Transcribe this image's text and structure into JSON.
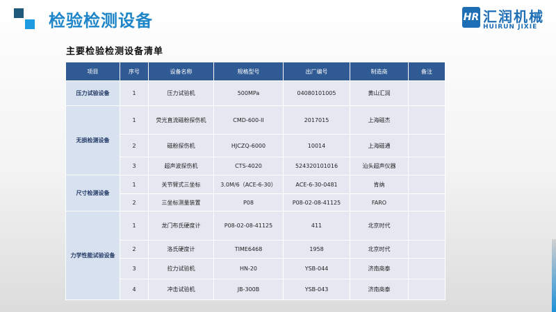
{
  "slide": {
    "title": "检验检测设备",
    "subtitle": "主要检验检测设备清单"
  },
  "logo": {
    "mark": "HR",
    "name_cn": "汇润机械",
    "name_en": "HUIRUN JIXIE"
  },
  "colors": {
    "title_blue": "#1e86c8",
    "header_bg": "#2f5a93",
    "cell_bg": "#e5e8f1",
    "group_bg": "#d8e1f0"
  },
  "table": {
    "headers": [
      "项目",
      "序号",
      "设备名称",
      "规格型号",
      "出厂编号",
      "制造商",
      "备注"
    ],
    "groups": [
      {
        "name": "压力试验设备",
        "rows": [
          {
            "no": "1",
            "name": "压力试验机",
            "model": "500MPa",
            "serial": "04080101005",
            "maker": "黄山汇润",
            "note": ""
          }
        ]
      },
      {
        "name": "无损检测设备",
        "rows": [
          {
            "no": "1",
            "name": "荧光直流磁粉探伤机",
            "model": "CMD-600-II",
            "serial": "2017015",
            "maker": "上海磁杰",
            "note": ""
          },
          {
            "no": "2",
            "name": "磁粉探伤机",
            "model": "HJCZQ-6000",
            "serial": "10014",
            "maker": "上海磁通",
            "note": ""
          },
          {
            "no": "3",
            "name": "超声波探伤机",
            "model": "CTS-4020",
            "serial": "524320101016",
            "maker": "汕头超声仪器",
            "note": ""
          }
        ]
      },
      {
        "name": "尺寸检测设备",
        "rows": [
          {
            "no": "1",
            "name": "关节臂式三坐标",
            "model": "3.0M/6（ACE-6-30）",
            "serial": "ACE-6-30-0481",
            "maker": "肯纳",
            "note": ""
          },
          {
            "no": "2",
            "name": "三坐标测量装置",
            "model": "P08",
            "serial": "P08-02-08-41125",
            "maker": "FARO",
            "note": ""
          }
        ]
      },
      {
        "name": "力学性能试验设备",
        "rows": [
          {
            "no": "1",
            "name": "龙门布氏硬度计",
            "model": "P08-02-08-41125",
            "serial": "411",
            "maker": "北京时代",
            "note": ""
          },
          {
            "no": "2",
            "name": "洛氏硬度计",
            "model": "TIME6468",
            "serial": "1958",
            "maker": "北京时代",
            "note": ""
          },
          {
            "no": "3",
            "name": "拉力试验机",
            "model": "HN-20",
            "serial": "YSB-044",
            "maker": "济南商泰",
            "note": ""
          },
          {
            "no": "4",
            "name": "冲击试验机",
            "model": "JB-300B",
            "serial": "YSB-043",
            "maker": "济南商泰",
            "note": ""
          }
        ]
      }
    ]
  }
}
